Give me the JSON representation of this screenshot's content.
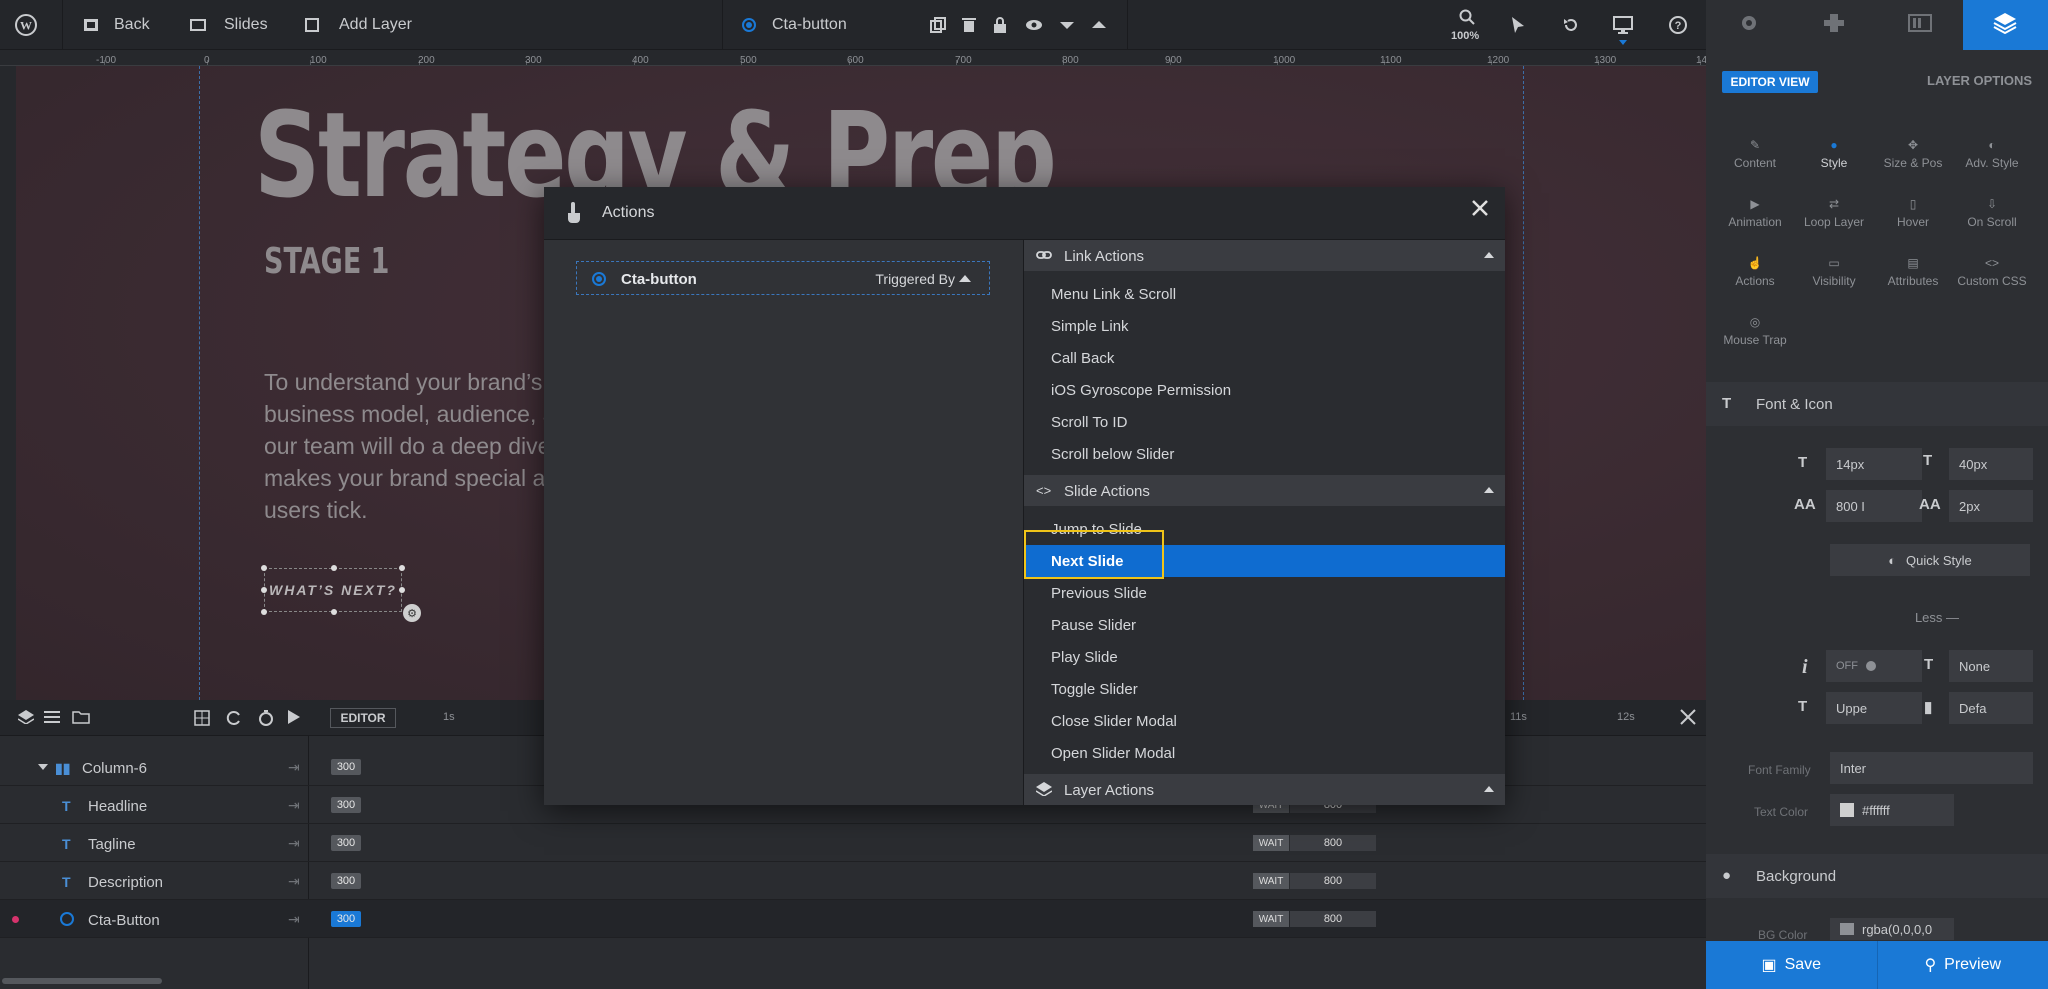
{
  "topbar": {
    "back_label": "Back",
    "slides_label": "Slides",
    "add_layer_label": "Add Layer",
    "selected_layer": "Cta-button",
    "zoom": "100%"
  },
  "ruler": {
    "ticks": [
      "-100",
      "0",
      "100",
      "200",
      "300",
      "400",
      "500",
      "600",
      "700",
      "800",
      "900",
      "1000",
      "1100",
      "1200",
      "1300",
      "14"
    ]
  },
  "canvas": {
    "headline": "Strategy & Prep",
    "tagline": "STAGE 1",
    "description": "To understand your brand’s business model, audience, a our team will do a deep dive makes your brand special ar users tick.",
    "cta": "WHAT’S NEXT?"
  },
  "timeline": {
    "editor_label": "EDITOR",
    "sec_1": "1s",
    "sec_11": "11s",
    "sec_12": "12s",
    "rows": [
      {
        "name": "Column-6",
        "start": "300",
        "wait": "",
        "duration": ""
      },
      {
        "name": "Headline",
        "start": "300",
        "wait": "WAIT",
        "duration": "800"
      },
      {
        "name": "Tagline",
        "start": "300",
        "wait": "WAIT",
        "duration": "800"
      },
      {
        "name": "Description",
        "start": "300",
        "wait": "WAIT",
        "duration": "800"
      },
      {
        "name": "Cta-Button",
        "start": "300",
        "wait": "WAIT",
        "duration": "800"
      }
    ]
  },
  "modal": {
    "title": "Actions",
    "trigger_name": "Cta-button",
    "triggered_by": "Triggered By",
    "groups": {
      "link": "Link Actions",
      "slide": "Slide Actions",
      "layer": "Layer Actions"
    },
    "link_actions": [
      "Menu Link & Scroll",
      "Simple Link",
      "Call Back",
      "iOS Gyroscope Permission",
      "Scroll To ID",
      "Scroll below Slider"
    ],
    "slide_actions": [
      "Jump to Slide",
      "Next Slide",
      "Previous Slide",
      "Pause Slider",
      "Play Slide",
      "Toggle Slider",
      "Close Slider Modal",
      "Open Slider Modal"
    ],
    "selected_action": "Next Slide"
  },
  "rpanel": {
    "editor_view": "EDITOR VIEW",
    "layer_options": "LAYER OPTIONS",
    "options": [
      "Content",
      "Style",
      "Size & Pos",
      "Adv. Style",
      "Animation",
      "Loop Layer",
      "Hover",
      "On Scroll",
      "Actions",
      "Visibility",
      "Attributes",
      "Custom CSS",
      "Mouse Trap"
    ],
    "font_icon": "Font & Icon",
    "font_size": "14px",
    "line_height": "40px",
    "font_weight": "800 I",
    "letter_spacing": "2px",
    "quick_style": "Quick Style",
    "less": "Less —",
    "italic_toggle": "OFF",
    "text_decoration": "None",
    "text_transform": "Uppe",
    "cursor": "Defa",
    "font_family_label": "Font Family",
    "font_family": "Inter",
    "text_color_label": "Text Color",
    "text_color": "#ffffff",
    "background": "Background",
    "bg_color_label": "BG Color",
    "bg_color": "rgba(0,0,0,0",
    "save": "Save",
    "preview": "Preview"
  },
  "colors": {
    "accent": "#1a79d6",
    "highlight": "#f0c419"
  }
}
